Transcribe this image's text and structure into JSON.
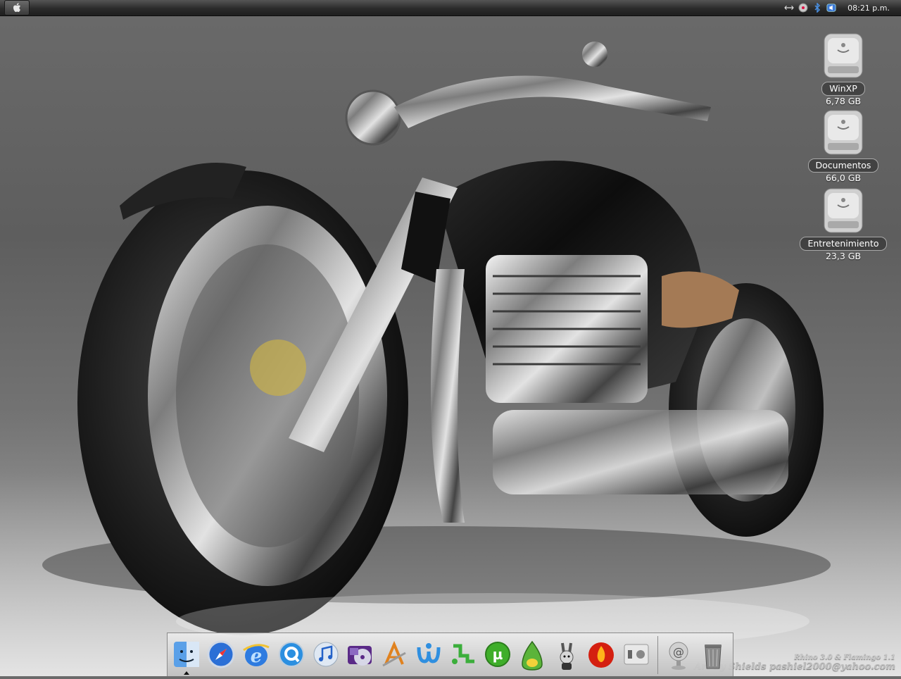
{
  "menubar": {
    "clock": "08:21 p.m.",
    "tray_icons": [
      "network-arrows-icon",
      "cd-icon",
      "bluetooth-icon",
      "volume-icon"
    ]
  },
  "desktop": {
    "drives": [
      {
        "name": "WinXP",
        "size": "6,78 GB",
        "icon": "hard-drive-icon"
      },
      {
        "name": "Documentos",
        "size": "66,0 GB",
        "icon": "hard-drive-icon"
      },
      {
        "name": "Entretenimiento",
        "size": "23,3 GB",
        "icon": "hard-drive-icon"
      }
    ]
  },
  "wallpaper": {
    "subject": "chrome-motorcycle",
    "credit_line1": "Rhino 3.0 & Flamingo 1.1",
    "credit_line2": "Art by Shields pashiel2000@yahoo.com"
  },
  "dock": {
    "apps": [
      {
        "name": "Finder",
        "icon": "finder-icon",
        "running": true
      },
      {
        "name": "Safari",
        "icon": "safari-compass-icon"
      },
      {
        "name": "Internet Explorer",
        "icon": "internet-explorer-icon"
      },
      {
        "name": "QuickTime",
        "icon": "quicktime-icon"
      },
      {
        "name": "iTunes",
        "icon": "itunes-icon"
      },
      {
        "name": "DVD Player",
        "icon": "dvd-player-icon"
      },
      {
        "name": "Applications",
        "icon": "applications-icon"
      },
      {
        "name": "Messenger",
        "icon": "messenger-icon"
      },
      {
        "name": "Network",
        "icon": "network-icon"
      },
      {
        "name": "uTorrent",
        "icon": "utorrent-icon"
      },
      {
        "name": "Azureus",
        "icon": "azureus-frog-icon"
      },
      {
        "name": "Rabbit",
        "icon": "rabbit-mascot-icon"
      },
      {
        "name": "Flame",
        "icon": "flame-orb-icon"
      },
      {
        "name": "Boot Camp",
        "icon": "bootcamp-icon"
      }
    ],
    "docklets": [
      {
        "name": "Mail",
        "icon": "mail-at-icon"
      },
      {
        "name": "Trash",
        "icon": "trash-icon"
      }
    ]
  }
}
